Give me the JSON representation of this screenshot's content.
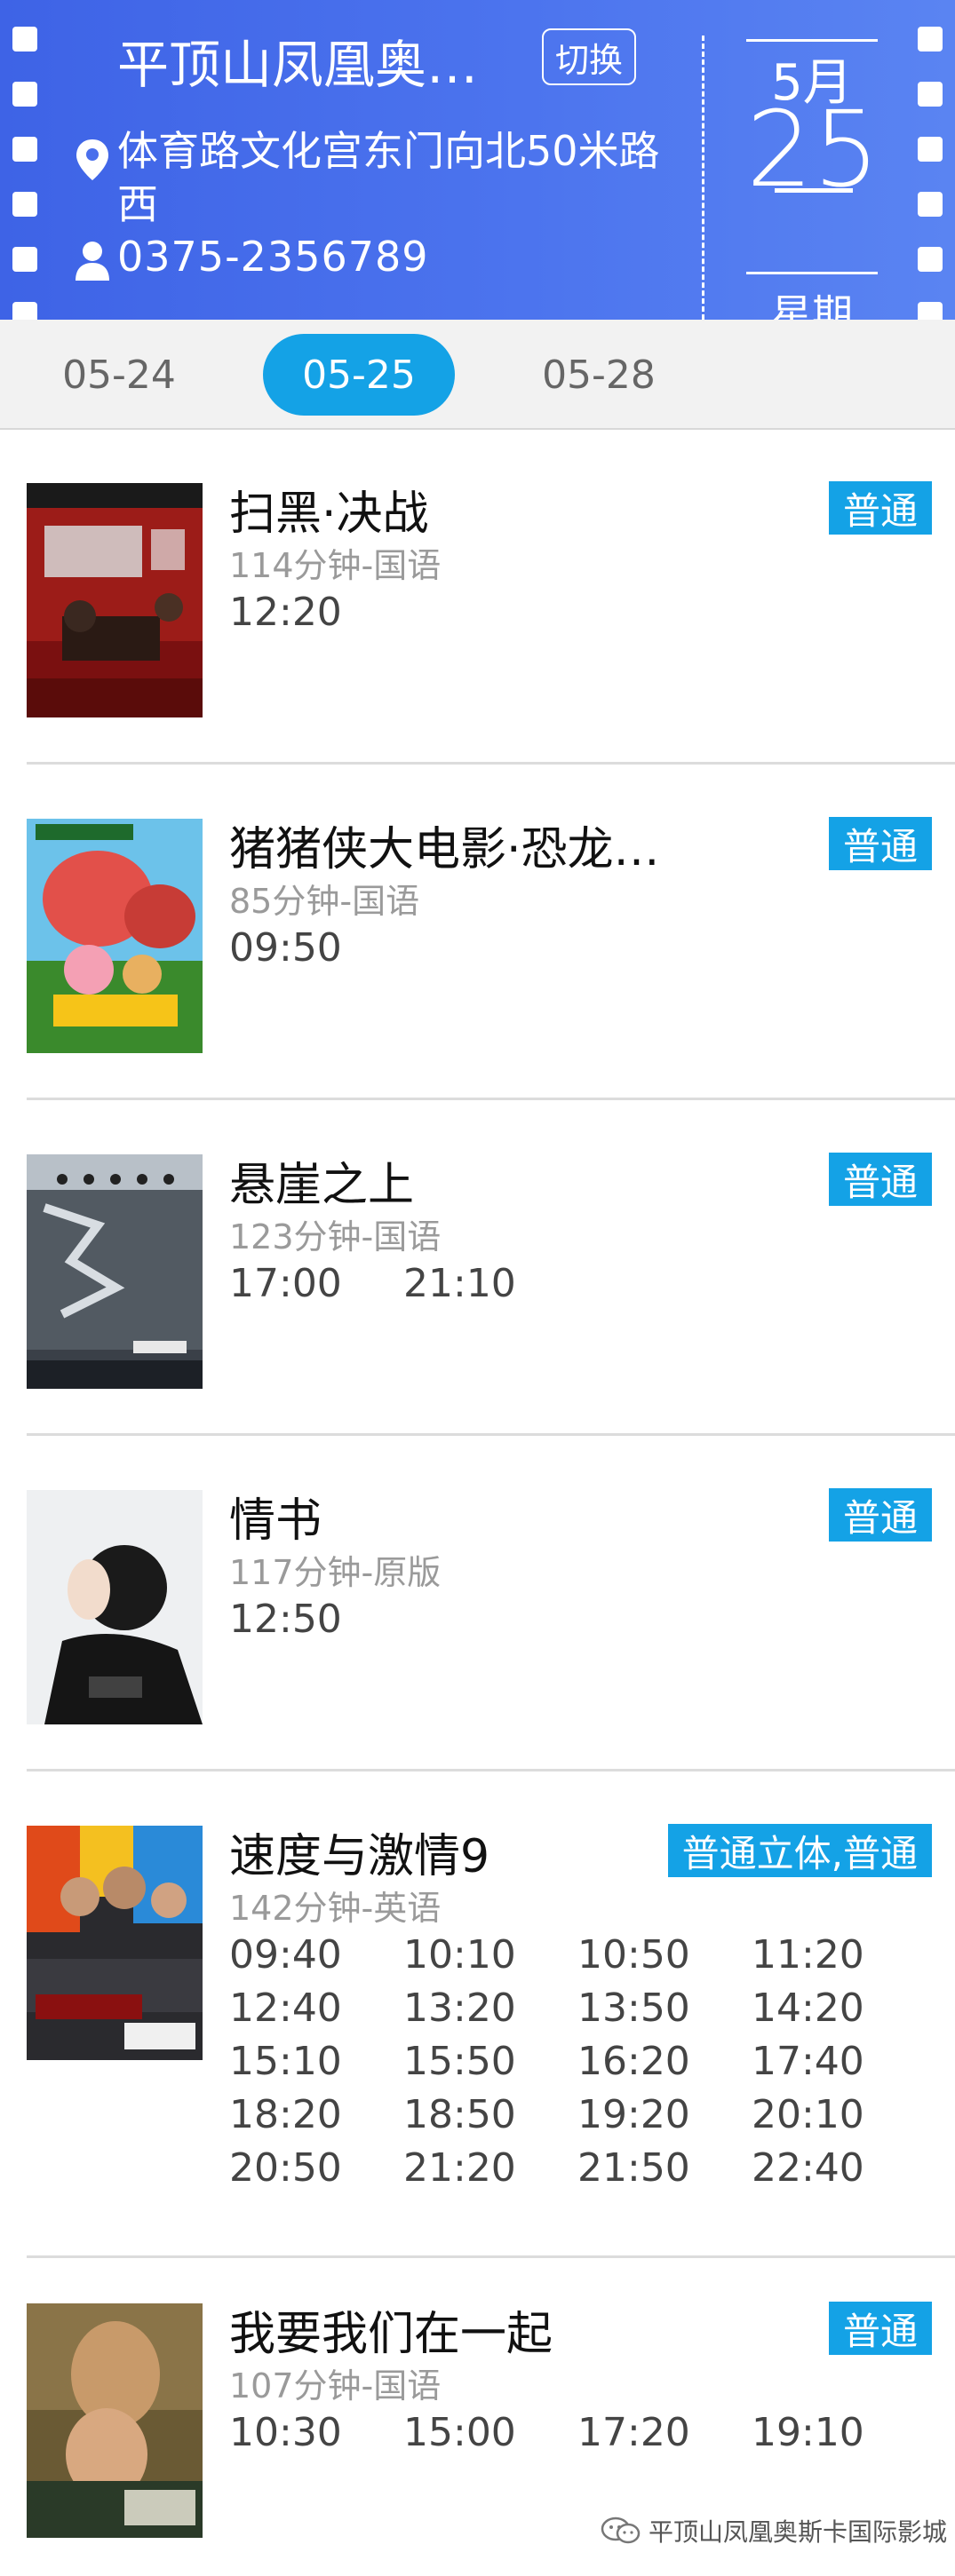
{
  "header": {
    "cinema_name": "平顶山凤凰奥…",
    "switch_label": "切换",
    "address": "体育路文化宫东门向北50米路西",
    "phone": "0375-2356789",
    "date_month": "5月",
    "date_day": "25",
    "date_weekday": "星期"
  },
  "date_tabs": [
    {
      "label": "05-24",
      "active": false
    },
    {
      "label": "05-25",
      "active": true
    },
    {
      "label": "05-28",
      "active": false
    }
  ],
  "movies": [
    {
      "title": "扫黑·决战",
      "meta": "114分钟-国语",
      "badge": "普通",
      "poster_icon": "poster-saohei",
      "times": [
        "12:20"
      ]
    },
    {
      "title": "猪猪侠大电影·恐龙…",
      "meta": "85分钟-国语",
      "badge": "普通",
      "poster_icon": "poster-zhuzhuxia",
      "times": [
        "09:50"
      ]
    },
    {
      "title": "悬崖之上",
      "meta": "123分钟-国语",
      "badge": "普通",
      "poster_icon": "poster-xuanya",
      "times": [
        "17:00",
        "21:10"
      ]
    },
    {
      "title": "情书",
      "meta": "117分钟-原版",
      "badge": "普通",
      "poster_icon": "poster-qingshu",
      "times": [
        "12:50"
      ]
    },
    {
      "title": "速度与激情9",
      "meta": "142分钟-英语",
      "badge": "普通立体,普通",
      "poster_icon": "poster-sudu",
      "times": [
        "09:40",
        "10:10",
        "10:50",
        "11:20",
        "12:40",
        "13:20",
        "13:50",
        "14:20",
        "15:10",
        "15:50",
        "16:20",
        "17:40",
        "18:20",
        "18:50",
        "19:20",
        "20:10",
        "20:50",
        "21:20",
        "21:50",
        "22:40"
      ]
    },
    {
      "title": "我要我们在一起",
      "meta": "107分钟-国语",
      "badge": "普通",
      "poster_icon": "poster-women",
      "times": [
        "10:30",
        "15:00",
        "17:20",
        "19:10"
      ]
    }
  ],
  "watermark": "平顶山凤凰奥斯卡国际影城",
  "colors": {
    "header_blue": "#4c74ee",
    "accent_blue": "#14a2e6"
  }
}
